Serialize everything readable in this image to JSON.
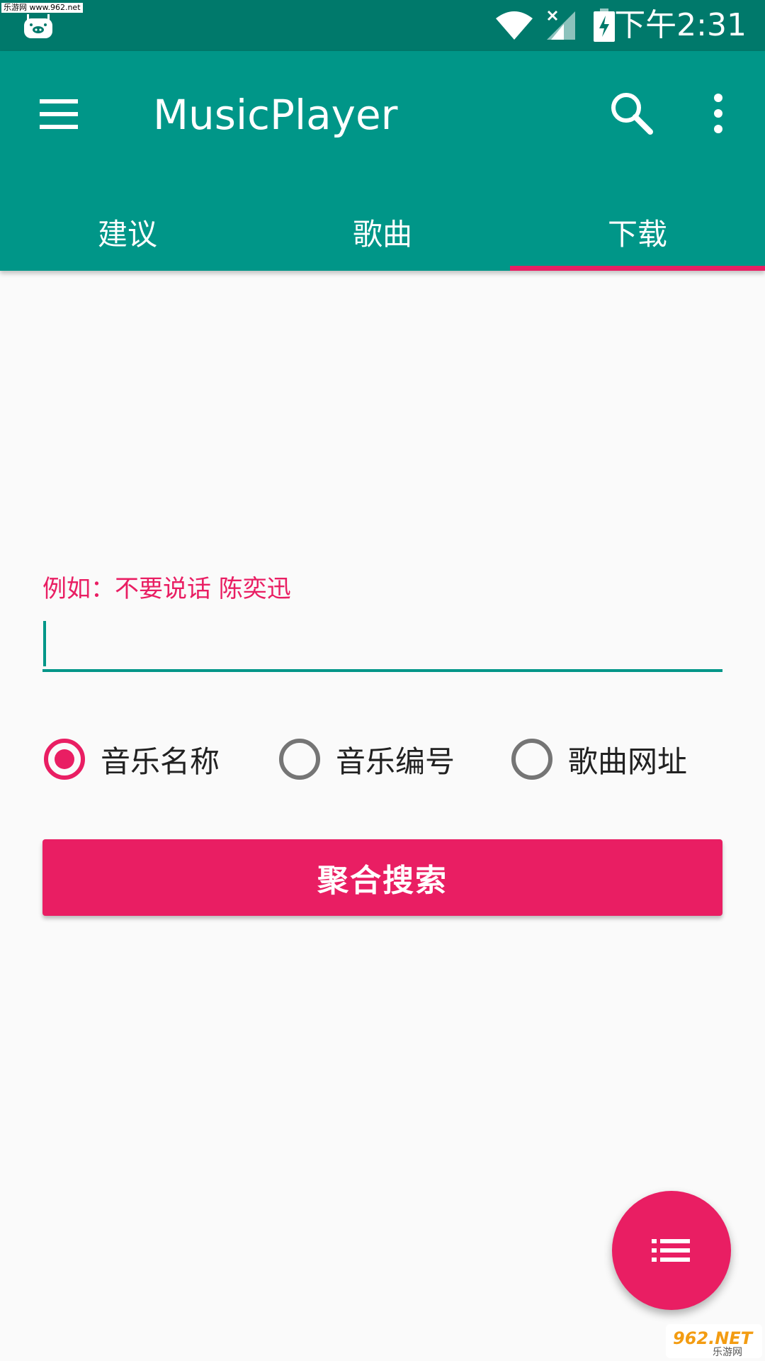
{
  "status_bar": {
    "watermark": "乐游网 www.962.net",
    "time": "下午2:31",
    "icons": [
      "app-notification-icon",
      "wifi-icon",
      "signal-off-icon",
      "battery-charging-icon"
    ]
  },
  "app_bar": {
    "title": "MusicPlayer",
    "menu_icon": "menu-icon",
    "search_icon": "search-icon",
    "more_icon": "more-vert-icon"
  },
  "tabs": [
    {
      "label": "建议",
      "active": false
    },
    {
      "label": "歌曲",
      "active": false
    },
    {
      "label": "下载",
      "active": true
    }
  ],
  "form": {
    "hint": "例如：不要说话 陈奕迅",
    "input_value": "",
    "radios": [
      {
        "label": "音乐名称",
        "checked": true
      },
      {
        "label": "音乐编号",
        "checked": false
      },
      {
        "label": "歌曲网址",
        "checked": false
      }
    ],
    "search_button": "聚合搜索"
  },
  "fab": {
    "icon": "list-icon"
  },
  "watermark_bottom": {
    "text_main": "962.NET",
    "text_sub": "乐游网"
  },
  "colors": {
    "primary": "#009688",
    "primary_dark": "#00796b",
    "accent": "#e91e63",
    "background": "#fafafa"
  }
}
